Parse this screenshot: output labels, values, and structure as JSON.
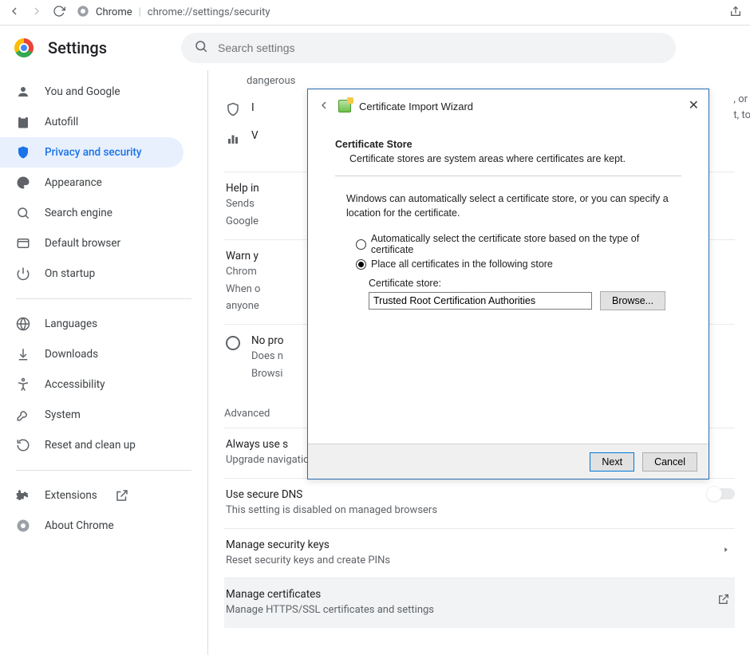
{
  "toolbar": {
    "app_label": "Chrome",
    "url": "chrome://settings/security"
  },
  "header": {
    "title": "Settings",
    "search_placeholder": "Search settings"
  },
  "sidebar": {
    "items": [
      {
        "label": "You and Google"
      },
      {
        "label": "Autofill"
      },
      {
        "label": "Privacy and security"
      },
      {
        "label": "Appearance"
      },
      {
        "label": "Search engine"
      },
      {
        "label": "Default browser"
      },
      {
        "label": "On startup"
      }
    ],
    "items2": [
      {
        "label": "Languages"
      },
      {
        "label": "Downloads"
      },
      {
        "label": "Accessibility"
      },
      {
        "label": "System"
      },
      {
        "label": "Reset and clean up"
      }
    ],
    "items3": [
      {
        "label": "Extensions"
      },
      {
        "label": "About Chrome"
      }
    ]
  },
  "main": {
    "dangerous": "dangerous",
    "truncated1": "I",
    "truncated2a": ", or",
    "truncated2b": "t, to",
    "truncated3": "V",
    "help_title": "Help in",
    "help_desc1": "Sends",
    "help_desc2": "Google",
    "warn_title": "Warn y",
    "warn_desc1": "Chrom",
    "warn_desc2": "When o",
    "warn_desc3": "anyone",
    "nopro_title": "No pro",
    "nopro_desc1": "Does n",
    "nopro_desc2": "Browsi",
    "advanced": "Advanced",
    "https_title": "Always use s",
    "https_desc": "Upgrade navigations to HTTPS and warn you before loading sites that don't support it",
    "dns_title": "Use secure DNS",
    "dns_desc": "This setting is disabled on managed browsers",
    "keys_title": "Manage security keys",
    "keys_desc": "Reset security keys and create PINs",
    "certs_title": "Manage certificates",
    "certs_desc": "Manage HTTPS/SSL certificates and settings"
  },
  "dialog": {
    "title": "Certificate Import Wizard",
    "heading": "Certificate Store",
    "sub": "Certificate stores are system areas where certificates are kept.",
    "para": "Windows can automatically select a certificate store, or you can specify a location for the certificate.",
    "radio_auto": "Automatically select the certificate store based on the type of certificate",
    "radio_place": "Place all certificates in the following store",
    "store_label": "Certificate store:",
    "store_value": "Trusted Root Certification Authorities",
    "browse": "Browse...",
    "next": "Next",
    "cancel": "Cancel"
  }
}
